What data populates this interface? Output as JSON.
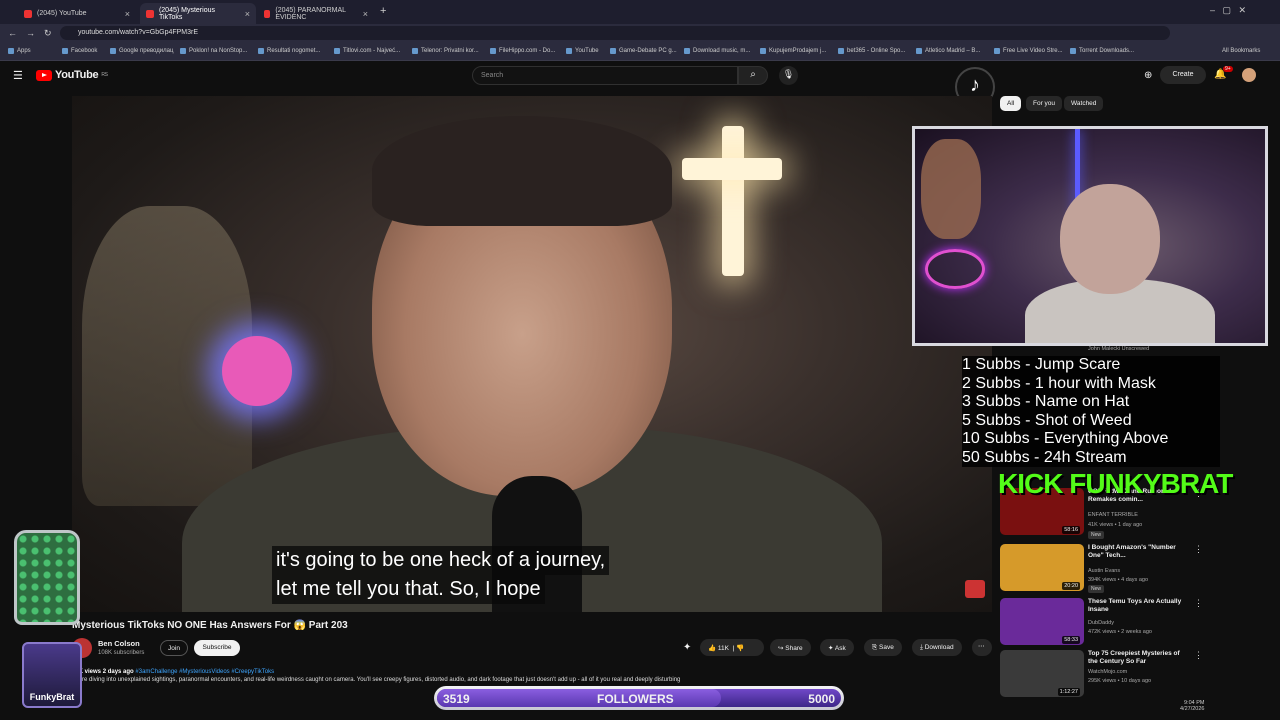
{
  "browser": {
    "tabs": [
      {
        "label": "(2045) YouTube"
      },
      {
        "label": "(2045) Mysterious TikToks"
      },
      {
        "label": "(2045) PARANORMAL EVIDENC"
      }
    ],
    "url": "youtube.com/watch?v=GbGp4FPM3rE",
    "bookmarks": [
      "Apps",
      "Facebook",
      "Google преводилац",
      "Poklon! na NonStop...",
      "Resultati nogomet...",
      "Titlovi.com - Najveć...",
      "Telenor: Privatni kor...",
      "FileHippo.com - Do...",
      "YouTube",
      "Game-Debate PC g...",
      "Download music, m...",
      "KupujemProdajem j...",
      "bet365 - Online Spo...",
      "Atletico Madrid – B...",
      "Free Live Video Stre...",
      "Torrent Downloads..."
    ],
    "all_bookmarks": "All Bookmarks"
  },
  "yt": {
    "logo": "YouTube",
    "region": "RS",
    "search_placeholder": "Search",
    "create": "Create",
    "notif_count": "9+"
  },
  "video": {
    "caption_line1": "it's going to be one heck of a journey,",
    "caption_line2": "let me tell you that. So, I hope",
    "title": "Mysterious TikToks NO ONE Has Answers For 😱 Part 203",
    "channel": "Ben Colson",
    "subscribers": "108K subscribers",
    "join": "Join",
    "subscribe": "Subscribe",
    "likes": "11K",
    "share": "Share",
    "ask": "Ask",
    "save": "Save",
    "download": "Download",
    "views": "43K views",
    "age": "2 days ago",
    "tags": "#3amChallenge #MysteriousVideos #CreepyTikToks",
    "description": "We're diving into unexplained sightings, paranormal encounters, and real-life weirdness caught on camera. You'll see creepy figures, distorted audio, and dark footage that just doesn't add up - all of it you real and deeply disturbing"
  },
  "chips": [
    "All",
    "For you",
    "Watched"
  ],
  "stream_goals": [
    "1 Subbs - Jump Scare",
    "2 Subbs - 1 hour with Mask",
    "3 Subbs - Name on Hat",
    "5 Subbs - Shot of Weed",
    "10 Subbs - Everything Above",
    "50 Subbs - 24h Stream"
  ],
  "partial_channel": "John Malecki Unscrewed",
  "recommended": [
    {
      "title": "CONFIRMED and Rumored Remakes comin...",
      "channel": "ENFANT TERRIBLE",
      "meta": "41K views • 1 day ago",
      "duration": "58:16",
      "badge": "New",
      "thumb": "#7a1010"
    },
    {
      "title": "I Bought Amazon's \"Number One\" Tech...",
      "channel": "Austin Evans",
      "meta": "394K views • 4 days ago",
      "duration": "20:20",
      "badge": "New",
      "thumb": "#d69a2a"
    },
    {
      "title": "These Temu Toys Are Actually Insane",
      "channel": "DubDaddy",
      "meta": "472K views • 2 weeks ago",
      "duration": "58:33",
      "badge": "",
      "thumb": "#6a2a9a"
    },
    {
      "title": "Top 75 Creepiest Mysteries of the Century So Far",
      "channel": "WatchMojo.com",
      "meta": "295K views • 10 days ago",
      "duration": "1:12:27",
      "badge": "",
      "thumb": "#3a3a3a"
    }
  ],
  "overlay": {
    "kick": "KICK FUNKYBRAT",
    "funky": "FunkyBrat",
    "followers_current": "3519",
    "followers_label": "FOLLOWERS",
    "followers_goal": "5000",
    "followers_progress": 0.7038
  },
  "tray": {
    "time": "9:04 PM",
    "date": "4/27/2026"
  },
  "colors": {
    "accent": "#ff0000",
    "goal_bar": "#7048c8",
    "link": "#3ea6ff"
  }
}
